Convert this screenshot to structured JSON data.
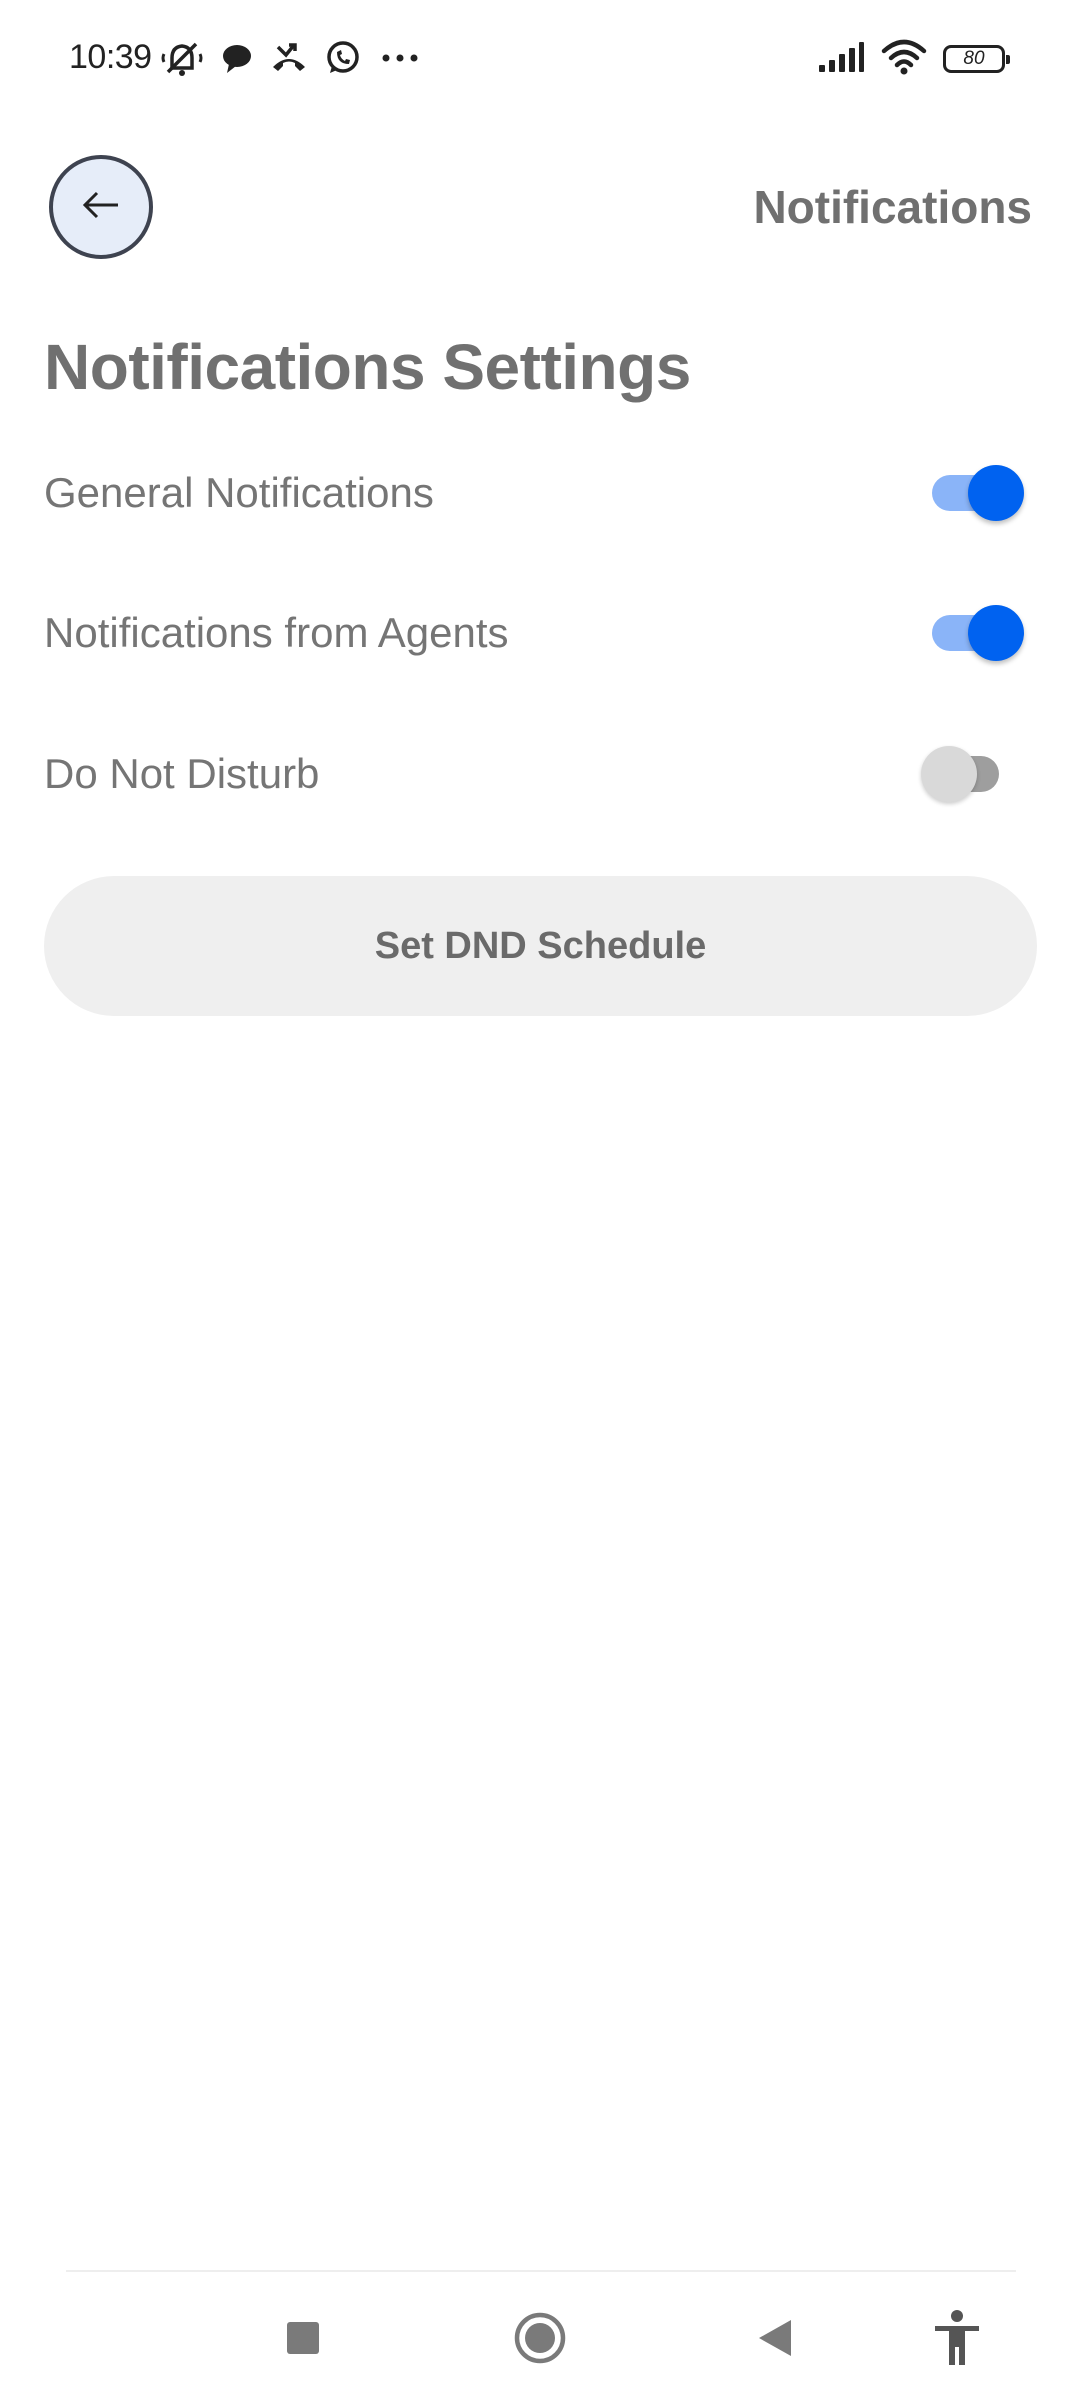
{
  "status_bar": {
    "time": "10:39",
    "battery": "80",
    "left_icons": [
      "muted-bell-icon",
      "chat-bubble-icon",
      "missed-call-icon",
      "whatsapp-icon",
      "more-dots-icon"
    ],
    "right_icons": [
      "signal-icon",
      "wifi-icon",
      "battery-icon"
    ]
  },
  "header": {
    "back_icon": "arrow-left-icon",
    "title": "Notifications"
  },
  "main": {
    "section_title": "Notifications Settings",
    "settings": [
      {
        "label": "General Notifications",
        "enabled": true
      },
      {
        "label": "Notifications from Agents",
        "enabled": true
      },
      {
        "label": "Do Not Disturb",
        "enabled": false
      }
    ],
    "dnd_button_label": "Set DND Schedule"
  },
  "nav_bar": {
    "buttons": [
      "recents-square-icon",
      "home-circle-icon",
      "back-triangle-icon",
      "accessibility-icon"
    ]
  },
  "colors": {
    "accent": "#0062f0",
    "accent_track": "#8ab4f8",
    "text_gray": "#707070",
    "button_bg": "#efefef"
  }
}
